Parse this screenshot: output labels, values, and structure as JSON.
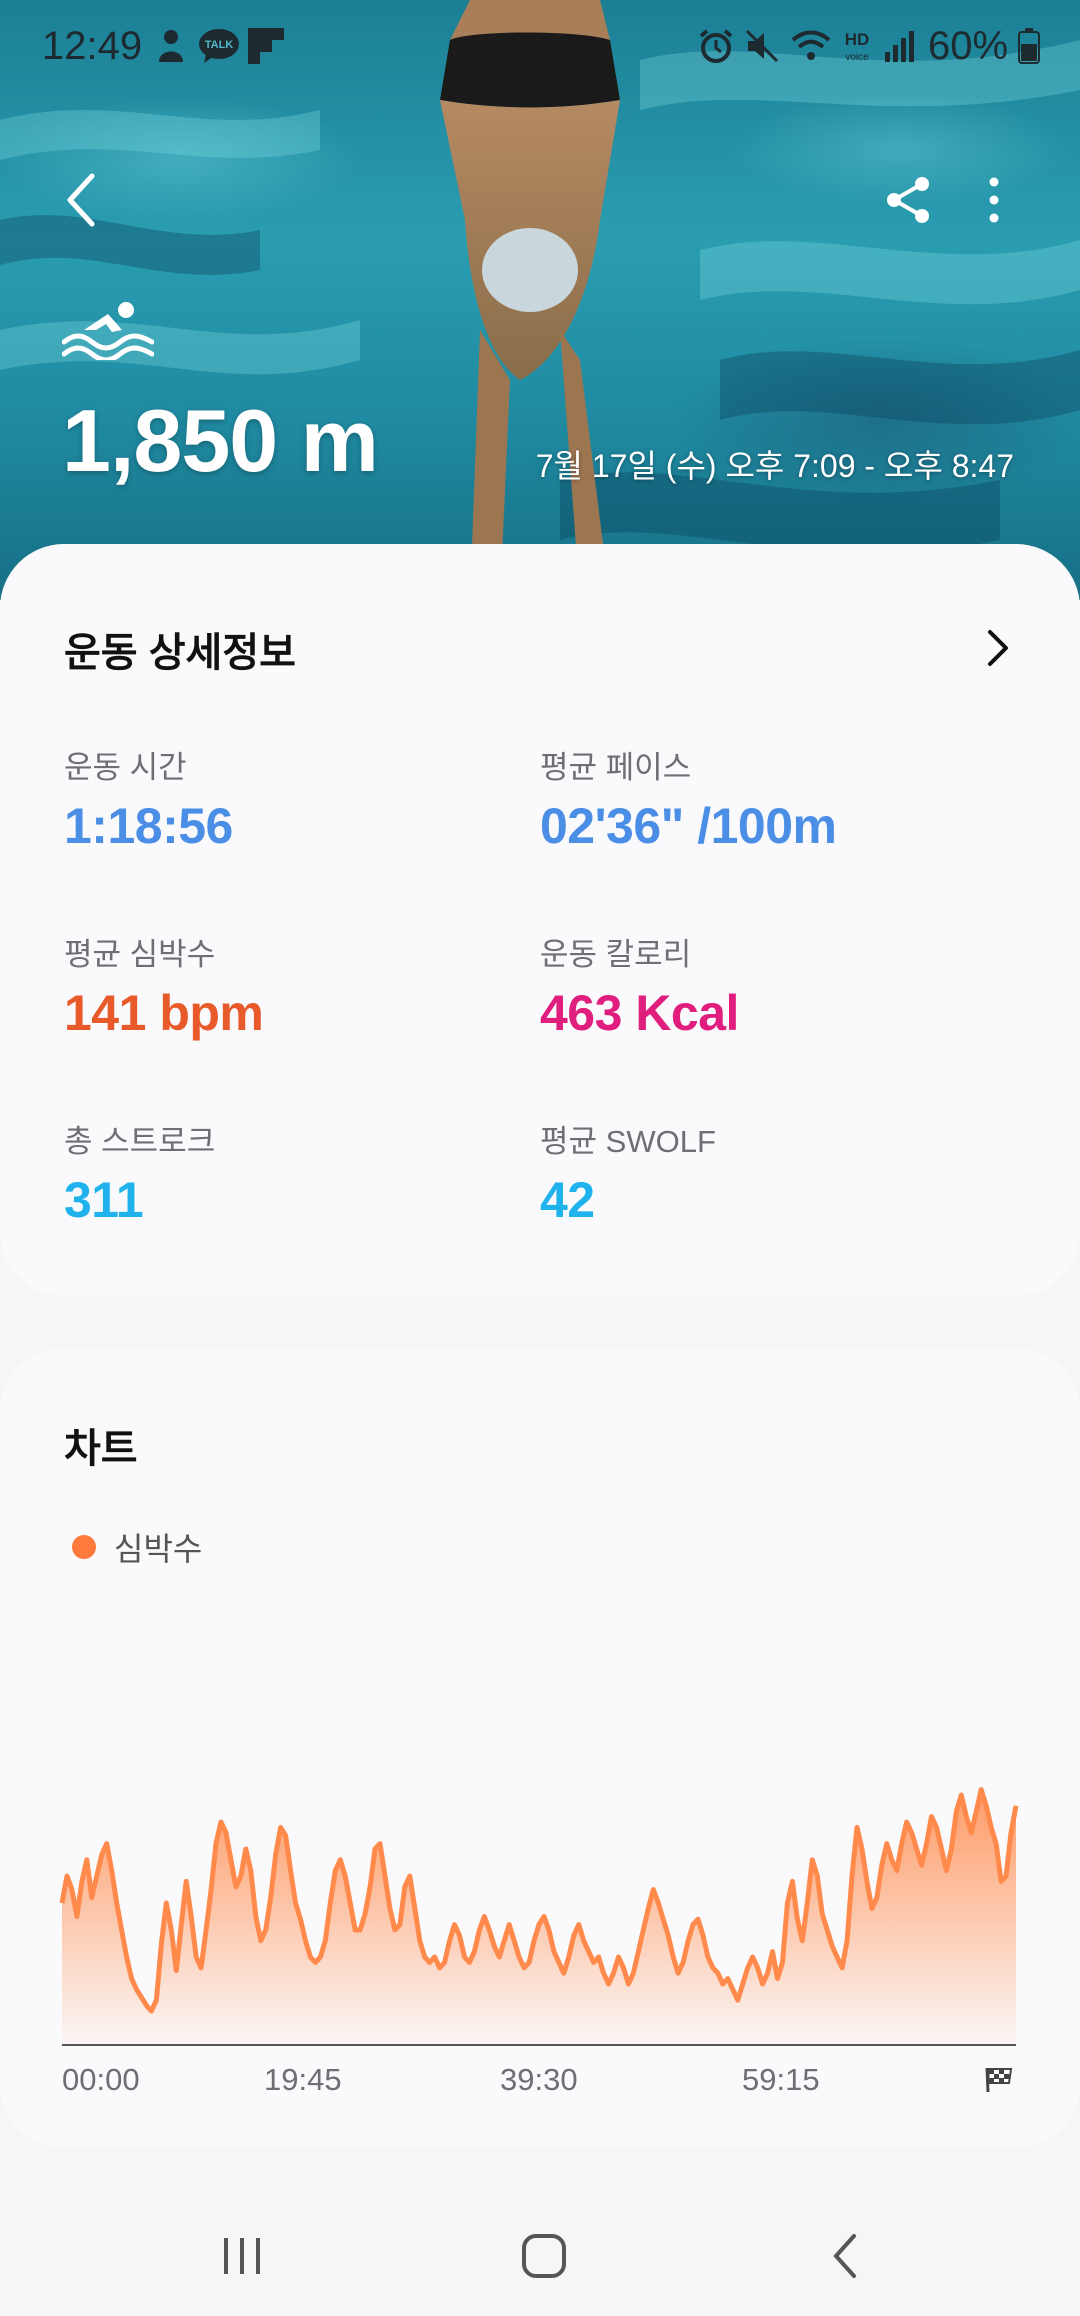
{
  "status_bar": {
    "time": "12:49",
    "battery": "60%",
    "left_icons": [
      "person-icon",
      "talk-icon",
      "flipboard-icon"
    ],
    "right_icons": [
      "alarm-icon",
      "mute-icon",
      "wifi-icon",
      "hd-voice-icon",
      "signal-icon",
      "battery-icon"
    ]
  },
  "header": {
    "activity_icon": "swimming-icon",
    "distance": "1,850 m",
    "date_range": "7월 17일 (수) 오후 7:09 - 오후 8:47"
  },
  "details": {
    "title": "운동 상세정보",
    "metrics": [
      {
        "label": "운동 시간",
        "value": "1:18:56",
        "color": "#4a8ee6"
      },
      {
        "label": "평균 페이스",
        "value": "02'36\" /100m",
        "color": "#4a8ee6"
      },
      {
        "label": "평균 심박수",
        "value": "141 bpm",
        "color": "#e85a2a"
      },
      {
        "label": "운동 칼로리",
        "value": "463 Kcal",
        "color": "#e01e7e"
      },
      {
        "label": "총 스트로크",
        "value": "311",
        "color": "#1fb2ec"
      },
      {
        "label": "평균 SWOLF",
        "value": "42",
        "color": "#1fb2ec"
      }
    ]
  },
  "chart_section": {
    "title": "차트"
  },
  "chart_data": {
    "type": "area",
    "series": [
      {
        "name": "심박수",
        "color": "#ff8a4c",
        "values": [
          0.5,
          0.6,
          0.55,
          0.45,
          0.58,
          0.66,
          0.52,
          0.6,
          0.68,
          0.72,
          0.62,
          0.5,
          0.4,
          0.3,
          0.22,
          0.18,
          0.15,
          0.12,
          0.1,
          0.14,
          0.35,
          0.5,
          0.4,
          0.25,
          0.42,
          0.58,
          0.45,
          0.3,
          0.26,
          0.4,
          0.55,
          0.72,
          0.8,
          0.76,
          0.66,
          0.56,
          0.6,
          0.7,
          0.62,
          0.45,
          0.36,
          0.4,
          0.52,
          0.68,
          0.78,
          0.75,
          0.62,
          0.5,
          0.44,
          0.36,
          0.3,
          0.28,
          0.3,
          0.36,
          0.5,
          0.62,
          0.66,
          0.6,
          0.5,
          0.4,
          0.4,
          0.46,
          0.56,
          0.7,
          0.72,
          0.6,
          0.48,
          0.4,
          0.42,
          0.56,
          0.6,
          0.48,
          0.36,
          0.3,
          0.28,
          0.3,
          0.26,
          0.28,
          0.36,
          0.42,
          0.38,
          0.3,
          0.28,
          0.32,
          0.4,
          0.45,
          0.4,
          0.34,
          0.3,
          0.36,
          0.42,
          0.36,
          0.3,
          0.26,
          0.28,
          0.36,
          0.42,
          0.45,
          0.4,
          0.32,
          0.28,
          0.24,
          0.3,
          0.38,
          0.42,
          0.36,
          0.32,
          0.28,
          0.3,
          0.24,
          0.2,
          0.24,
          0.3,
          0.26,
          0.2,
          0.24,
          0.32,
          0.4,
          0.48,
          0.55,
          0.5,
          0.44,
          0.38,
          0.3,
          0.24,
          0.28,
          0.36,
          0.42,
          0.44,
          0.38,
          0.3,
          0.26,
          0.24,
          0.2,
          0.22,
          0.18,
          0.14,
          0.2,
          0.26,
          0.3,
          0.26,
          0.2,
          0.24,
          0.32,
          0.22,
          0.28,
          0.5,
          0.58,
          0.44,
          0.36,
          0.5,
          0.66,
          0.6,
          0.46,
          0.4,
          0.34,
          0.3,
          0.26,
          0.36,
          0.6,
          0.78,
          0.7,
          0.58,
          0.48,
          0.52,
          0.64,
          0.72,
          0.66,
          0.62,
          0.72,
          0.8,
          0.76,
          0.7,
          0.64,
          0.72,
          0.82,
          0.78,
          0.7,
          0.62,
          0.7,
          0.84,
          0.9,
          0.82,
          0.76,
          0.84,
          0.92,
          0.86,
          0.78,
          0.72,
          0.58,
          0.6,
          0.76,
          0.86
        ]
      }
    ],
    "x_ticks": [
      "00:00",
      "19:45",
      "39:30",
      "59:15"
    ],
    "end_marker": "finish-flag-icon",
    "legend_position": "top-left",
    "grid": false
  },
  "nav_bar": {
    "items": [
      "recents-icon",
      "home-icon",
      "back-icon"
    ]
  }
}
